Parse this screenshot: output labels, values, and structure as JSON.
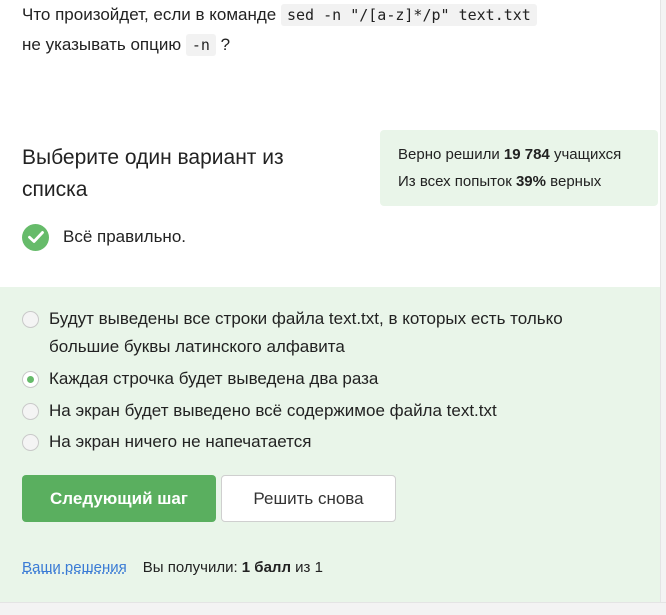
{
  "question": {
    "line1_prefix": "Что произойдет, если в команде",
    "command": "sed -n \"/[a-z]*/p\" text.txt",
    "line2_prefix": "не указывать опцию",
    "option_code": "-n",
    "line2_suffix": "?"
  },
  "choose_title": "Выберите один вариант из списка",
  "stats": {
    "line1_prefix": "Верно решили",
    "solved_count": "19 784",
    "line1_suffix": "учащихся",
    "line2_prefix": "Из всех попыток",
    "percent": "39%",
    "line2_suffix": "верных"
  },
  "result": {
    "icon": "check-circle-icon",
    "text": "Всё правильно."
  },
  "options": [
    {
      "line1": "Будут выведены все строки файла text.txt, в которых есть только",
      "line2": "большие буквы латинского алфавита",
      "checked": false
    },
    {
      "line1": "Каждая строчка будет выведена два раза",
      "checked": true
    },
    {
      "line1": "На экран будет выведено всё содержимое файла text.txt",
      "checked": false
    },
    {
      "line1": "На экран ничего не напечатается",
      "checked": false
    }
  ],
  "buttons": {
    "next": "Следующий шаг",
    "retry": "Решить снова"
  },
  "footer": {
    "solutions_link": "Ваши решения",
    "score_prefix": "Вы получили:",
    "score_value": "1 балл",
    "score_suffix": "из 1"
  },
  "colors": {
    "accent": "#66bb6a",
    "button": "#5aaf5f",
    "panel": "#e9f5e9",
    "link": "#3a7bd5"
  }
}
